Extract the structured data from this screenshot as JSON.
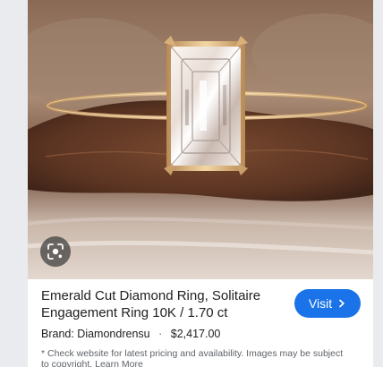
{
  "product": {
    "title": "Emerald Cut Diamond Ring, Solitaire Engagement Ring 10K / 1.70 ct",
    "brand_label": "Brand: Diamondrensu",
    "price": "$2,417.00",
    "visit_label": "Visit",
    "disclaimer": "* Check website for latest pricing and availability. Images may be subject to copyright.",
    "learn_more": "Learn More"
  },
  "icons": {
    "lens": "image-search-icon",
    "visit_arrow": "chevron-right-icon"
  },
  "colors": {
    "accent": "#1a73e8",
    "text_primary": "#202124",
    "text_secondary": "#5f6368",
    "page_bg": "#e9ebee"
  }
}
